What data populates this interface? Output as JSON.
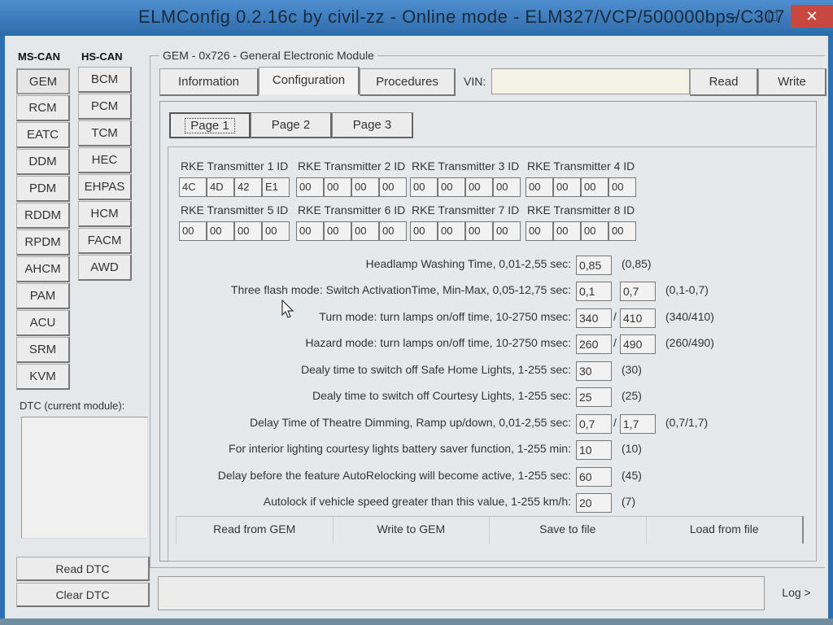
{
  "window": {
    "title": "ELMConfig 0.2.16c by civil-zz - Online mode - ELM327/VCP/500000bps/C307",
    "min_glyph": "–",
    "max_glyph": "□",
    "close_glyph": "✕"
  },
  "ms_can": {
    "header": "MS-CAN",
    "items": [
      "GEM",
      "RCM",
      "EATC",
      "DDM",
      "PDM",
      "RDDM",
      "RPDM",
      "AHCM",
      "PAM",
      "ACU",
      "SRM",
      "KVM"
    ]
  },
  "hs_can": {
    "header": "HS-CAN",
    "items": [
      "BCM",
      "PCM",
      "TCM",
      "HEC",
      "EHPAS",
      "HCM",
      "FACM",
      "AWD"
    ]
  },
  "dtc": {
    "label": "DTC (current module):",
    "read": "Read DTC",
    "clear": "Clear DTC"
  },
  "module": {
    "title": "GEM - 0x726 - General Electronic Module"
  },
  "tabs": {
    "information": "Information",
    "configuration": "Configuration",
    "procedures": "Procedures"
  },
  "vin": {
    "label": "VIN:",
    "value": "",
    "read": "Read",
    "write": "Write"
  },
  "pages": {
    "p1": "Page 1",
    "p2": "Page 2",
    "p3": "Page 3"
  },
  "rke": [
    {
      "label": "RKE Transmitter 1 ID",
      "bytes": [
        "4C",
        "4D",
        "42",
        "E1"
      ]
    },
    {
      "label": "RKE Transmitter 2 ID",
      "bytes": [
        "00",
        "00",
        "00",
        "00"
      ]
    },
    {
      "label": "RKE Transmitter 3 ID",
      "bytes": [
        "00",
        "00",
        "00",
        "00"
      ]
    },
    {
      "label": "RKE Transmitter 4 ID",
      "bytes": [
        "00",
        "00",
        "00",
        "00"
      ]
    },
    {
      "label": "RKE Transmitter 5 ID",
      "bytes": [
        "00",
        "00",
        "00",
        "00"
      ]
    },
    {
      "label": "RKE Transmitter 6 ID",
      "bytes": [
        "00",
        "00",
        "00",
        "00"
      ]
    },
    {
      "label": "RKE Transmitter 7 ID",
      "bytes": [
        "00",
        "00",
        "00",
        "00"
      ]
    },
    {
      "label": "RKE Transmitter 8 ID",
      "bytes": [
        "00",
        "00",
        "00",
        "00"
      ]
    }
  ],
  "params": [
    {
      "label": "Headlamp Washing Time, 0,01-2,55 sec:",
      "v1": "0,85",
      "def": "(0,85)"
    },
    {
      "label": "Three flash mode: Switch ActivationTime, Min-Max, 0,05-12,75 sec:",
      "v1": "0,1",
      "v2": "0,7",
      "def": "(0,1-0,7)"
    },
    {
      "label": "Turn mode: turn lamps on/off time, 10-2750 msec:",
      "v1": "340",
      "v2": "410",
      "slash": "/",
      "def": "(340/410)"
    },
    {
      "label": "Hazard mode: turn lamps on/off time, 10-2750 msec:",
      "v1": "260",
      "v2": "490",
      "slash": "/",
      "def": "(260/490)"
    },
    {
      "label": "Dealy time to switch off Safe Home Lights, 1-255 sec:",
      "v1": "30",
      "def": "(30)"
    },
    {
      "label": "Dealy time to switch off Courtesy Lights, 1-255 sec:",
      "v1": "25",
      "def": "(25)"
    },
    {
      "label": "Delay Time of Theatre Dimming, Ramp up/down, 0,01-2,55 sec:",
      "v1": "0,7",
      "v2": "1,7",
      "slash": "/",
      "def": "(0,7/1,7)"
    },
    {
      "label": "For interior lighting courtesy lights battery saver function, 1-255 min:",
      "v1": "10",
      "def": "(10)"
    },
    {
      "label": "Delay before the feature AutoRelocking will become active, 1-255 sec:",
      "v1": "60",
      "def": "(45)"
    },
    {
      "label": "Autolock if vehicle speed greater than this value, 1-255 km/h:",
      "v1": "20",
      "def": "(7)"
    }
  ],
  "actions": {
    "read": "Read from GEM",
    "write": "Write to GEM",
    "save": "Save to file",
    "load": "Load from file"
  },
  "log": "Log >"
}
